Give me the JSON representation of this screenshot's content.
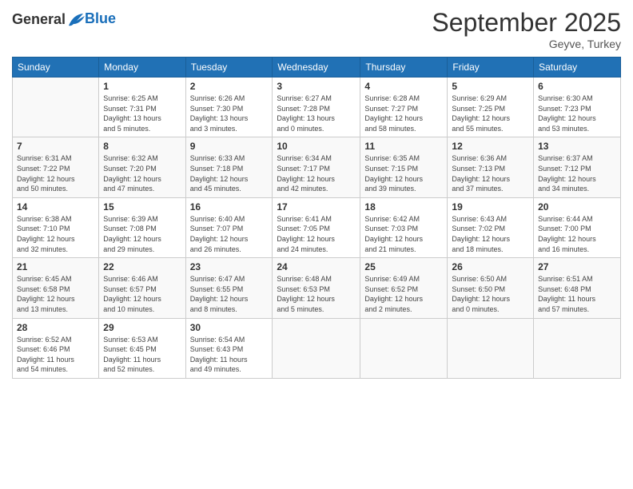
{
  "header": {
    "logo_line1": "General",
    "logo_line2": "Blue",
    "month": "September 2025",
    "location": "Geyve, Turkey"
  },
  "days_of_week": [
    "Sunday",
    "Monday",
    "Tuesday",
    "Wednesday",
    "Thursday",
    "Friday",
    "Saturday"
  ],
  "weeks": [
    [
      {
        "day": "",
        "info": ""
      },
      {
        "day": "1",
        "info": "Sunrise: 6:25 AM\nSunset: 7:31 PM\nDaylight: 13 hours\nand 5 minutes."
      },
      {
        "day": "2",
        "info": "Sunrise: 6:26 AM\nSunset: 7:30 PM\nDaylight: 13 hours\nand 3 minutes."
      },
      {
        "day": "3",
        "info": "Sunrise: 6:27 AM\nSunset: 7:28 PM\nDaylight: 13 hours\nand 0 minutes."
      },
      {
        "day": "4",
        "info": "Sunrise: 6:28 AM\nSunset: 7:27 PM\nDaylight: 12 hours\nand 58 minutes."
      },
      {
        "day": "5",
        "info": "Sunrise: 6:29 AM\nSunset: 7:25 PM\nDaylight: 12 hours\nand 55 minutes."
      },
      {
        "day": "6",
        "info": "Sunrise: 6:30 AM\nSunset: 7:23 PM\nDaylight: 12 hours\nand 53 minutes."
      }
    ],
    [
      {
        "day": "7",
        "info": "Sunrise: 6:31 AM\nSunset: 7:22 PM\nDaylight: 12 hours\nand 50 minutes."
      },
      {
        "day": "8",
        "info": "Sunrise: 6:32 AM\nSunset: 7:20 PM\nDaylight: 12 hours\nand 47 minutes."
      },
      {
        "day": "9",
        "info": "Sunrise: 6:33 AM\nSunset: 7:18 PM\nDaylight: 12 hours\nand 45 minutes."
      },
      {
        "day": "10",
        "info": "Sunrise: 6:34 AM\nSunset: 7:17 PM\nDaylight: 12 hours\nand 42 minutes."
      },
      {
        "day": "11",
        "info": "Sunrise: 6:35 AM\nSunset: 7:15 PM\nDaylight: 12 hours\nand 39 minutes."
      },
      {
        "day": "12",
        "info": "Sunrise: 6:36 AM\nSunset: 7:13 PM\nDaylight: 12 hours\nand 37 minutes."
      },
      {
        "day": "13",
        "info": "Sunrise: 6:37 AM\nSunset: 7:12 PM\nDaylight: 12 hours\nand 34 minutes."
      }
    ],
    [
      {
        "day": "14",
        "info": "Sunrise: 6:38 AM\nSunset: 7:10 PM\nDaylight: 12 hours\nand 32 minutes."
      },
      {
        "day": "15",
        "info": "Sunrise: 6:39 AM\nSunset: 7:08 PM\nDaylight: 12 hours\nand 29 minutes."
      },
      {
        "day": "16",
        "info": "Sunrise: 6:40 AM\nSunset: 7:07 PM\nDaylight: 12 hours\nand 26 minutes."
      },
      {
        "day": "17",
        "info": "Sunrise: 6:41 AM\nSunset: 7:05 PM\nDaylight: 12 hours\nand 24 minutes."
      },
      {
        "day": "18",
        "info": "Sunrise: 6:42 AM\nSunset: 7:03 PM\nDaylight: 12 hours\nand 21 minutes."
      },
      {
        "day": "19",
        "info": "Sunrise: 6:43 AM\nSunset: 7:02 PM\nDaylight: 12 hours\nand 18 minutes."
      },
      {
        "day": "20",
        "info": "Sunrise: 6:44 AM\nSunset: 7:00 PM\nDaylight: 12 hours\nand 16 minutes."
      }
    ],
    [
      {
        "day": "21",
        "info": "Sunrise: 6:45 AM\nSunset: 6:58 PM\nDaylight: 12 hours\nand 13 minutes."
      },
      {
        "day": "22",
        "info": "Sunrise: 6:46 AM\nSunset: 6:57 PM\nDaylight: 12 hours\nand 10 minutes."
      },
      {
        "day": "23",
        "info": "Sunrise: 6:47 AM\nSunset: 6:55 PM\nDaylight: 12 hours\nand 8 minutes."
      },
      {
        "day": "24",
        "info": "Sunrise: 6:48 AM\nSunset: 6:53 PM\nDaylight: 12 hours\nand 5 minutes."
      },
      {
        "day": "25",
        "info": "Sunrise: 6:49 AM\nSunset: 6:52 PM\nDaylight: 12 hours\nand 2 minutes."
      },
      {
        "day": "26",
        "info": "Sunrise: 6:50 AM\nSunset: 6:50 PM\nDaylight: 12 hours\nand 0 minutes."
      },
      {
        "day": "27",
        "info": "Sunrise: 6:51 AM\nSunset: 6:48 PM\nDaylight: 11 hours\nand 57 minutes."
      }
    ],
    [
      {
        "day": "28",
        "info": "Sunrise: 6:52 AM\nSunset: 6:46 PM\nDaylight: 11 hours\nand 54 minutes."
      },
      {
        "day": "29",
        "info": "Sunrise: 6:53 AM\nSunset: 6:45 PM\nDaylight: 11 hours\nand 52 minutes."
      },
      {
        "day": "30",
        "info": "Sunrise: 6:54 AM\nSunset: 6:43 PM\nDaylight: 11 hours\nand 49 minutes."
      },
      {
        "day": "",
        "info": ""
      },
      {
        "day": "",
        "info": ""
      },
      {
        "day": "",
        "info": ""
      },
      {
        "day": "",
        "info": ""
      }
    ]
  ]
}
